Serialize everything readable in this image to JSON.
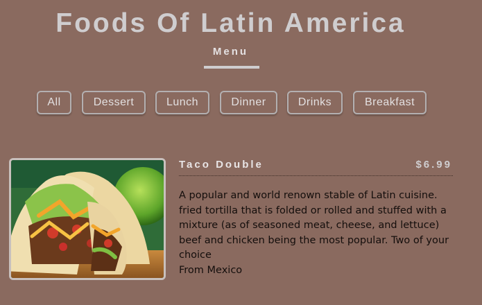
{
  "header": {
    "title": "Foods Of Latin America",
    "subtitle": "Menu"
  },
  "filters": [
    {
      "label": "All"
    },
    {
      "label": "Dessert"
    },
    {
      "label": "Lunch"
    },
    {
      "label": "Dinner"
    },
    {
      "label": "Drinks"
    },
    {
      "label": "Breakfast"
    }
  ],
  "menu_item": {
    "name": "Taco Double",
    "price": "$6.99",
    "description": "A popular and world renown stable of Latin cuisine. fried tortilla that is folded or rolled and stuffed with a mixture (as of seasoned meat, cheese, and lettuce) beef and chicken being the most popular. Two of your choice",
    "origin": "From Mexico",
    "image_icon": "taco-photo"
  },
  "colors": {
    "background": "#8a6a5f",
    "heading": "#cfcdcf",
    "body_text": "#140e0c"
  }
}
